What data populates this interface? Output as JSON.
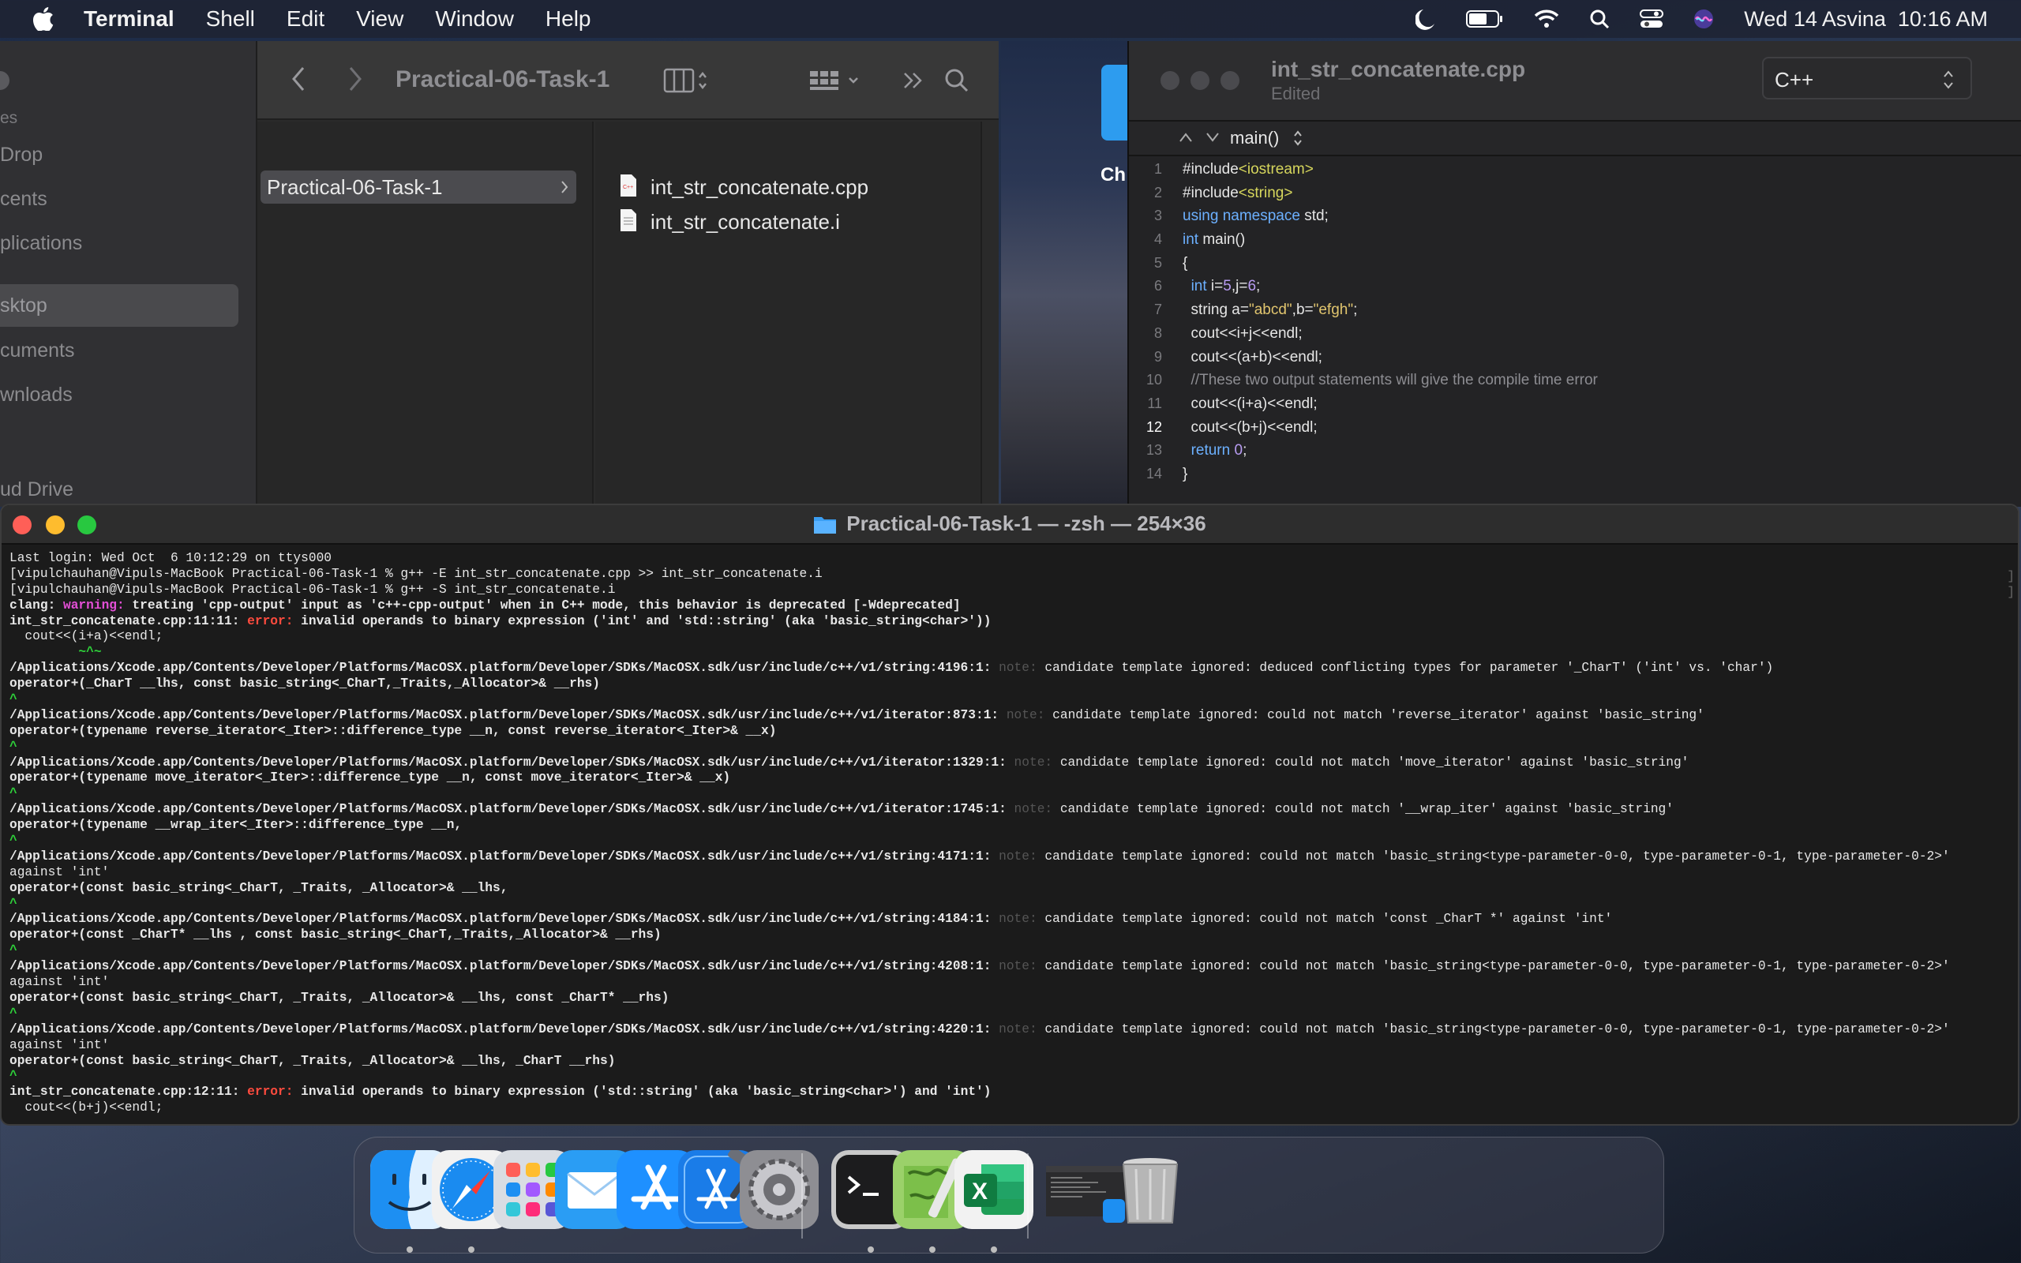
{
  "menubar": {
    "app": "Terminal",
    "items": [
      "Shell",
      "Edit",
      "View",
      "Window",
      "Help"
    ],
    "datetime": "Wed 14 Asvina  10:16 AM"
  },
  "finder": {
    "sidebar": {
      "section_label": "es",
      "items": [
        "Drop",
        "cents",
        "plications",
        "sktop",
        "cuments",
        "wnloads"
      ],
      "cloud_label": "ud Drive"
    },
    "toolbar": {
      "title": "Practical-06-Task-1"
    },
    "column1": {
      "folder": "Practical-06-Task-1"
    },
    "column2": {
      "files": [
        "int_str_concatenate.cpp",
        "int_str_concatenate.i"
      ]
    }
  },
  "desktop": {
    "partial_label": "Ch"
  },
  "editor": {
    "filename": "int_str_concatenate.cpp",
    "status": "Edited",
    "language": "C++",
    "jump": "main()",
    "current_line": "12",
    "lines": [
      {
        "n": "1",
        "parts": [
          {
            "t": "#include",
            "c": ""
          },
          {
            "t": "<iostream>",
            "c": "inc"
          }
        ]
      },
      {
        "n": "2",
        "parts": [
          {
            "t": "#include",
            "c": ""
          },
          {
            "t": "<string>",
            "c": "inc"
          }
        ]
      },
      {
        "n": "3",
        "parts": [
          {
            "t": "using namespace",
            "c": "kw"
          },
          {
            "t": " std;",
            "c": ""
          }
        ]
      },
      {
        "n": "4",
        "parts": [
          {
            "t": "int",
            "c": "kw"
          },
          {
            "t": " main()",
            "c": ""
          }
        ]
      },
      {
        "n": "5",
        "parts": [
          {
            "t": "{",
            "c": ""
          }
        ]
      },
      {
        "n": "6",
        "parts": [
          {
            "t": "  ",
            "c": ""
          },
          {
            "t": "int",
            "c": "kw"
          },
          {
            "t": " i=",
            "c": ""
          },
          {
            "t": "5",
            "c": "num"
          },
          {
            "t": ",j=",
            "c": ""
          },
          {
            "t": "6",
            "c": "num"
          },
          {
            "t": ";",
            "c": ""
          }
        ]
      },
      {
        "n": "7",
        "parts": [
          {
            "t": "  string a=",
            "c": ""
          },
          {
            "t": "\"abcd\"",
            "c": "strv"
          },
          {
            "t": ",b=",
            "c": ""
          },
          {
            "t": "\"efgh\"",
            "c": "strv"
          },
          {
            "t": ";",
            "c": ""
          }
        ]
      },
      {
        "n": "8",
        "parts": [
          {
            "t": "  cout<<i+j<<endl;",
            "c": ""
          }
        ]
      },
      {
        "n": "9",
        "parts": [
          {
            "t": "  cout<<(a+b)<<endl;",
            "c": ""
          }
        ]
      },
      {
        "n": "10",
        "parts": [
          {
            "t": "  //These two output statements will give the compile time error",
            "c": "cmt"
          }
        ]
      },
      {
        "n": "11",
        "parts": [
          {
            "t": "  cout<<(i+a)<<endl;",
            "c": ""
          }
        ]
      },
      {
        "n": "12",
        "parts": [
          {
            "t": "  cout<<(b+j)<<endl;",
            "c": ""
          }
        ]
      },
      {
        "n": "13",
        "parts": [
          {
            "t": "  ",
            "c": ""
          },
          {
            "t": "return",
            "c": "kw"
          },
          {
            "t": " ",
            "c": ""
          },
          {
            "t": "0",
            "c": "num"
          },
          {
            "t": ";",
            "c": ""
          }
        ]
      },
      {
        "n": "14",
        "parts": [
          {
            "t": "}",
            "c": ""
          }
        ]
      }
    ]
  },
  "terminal": {
    "title": "Practical-06-Task-1 — -zsh — 254×36",
    "lines": [
      [
        {
          "t": "Last login: Wed Oct  6 10:12:29 on ttys000",
          "c": ""
        }
      ],
      [
        {
          "t": "[vipulchauhan@Vipuls-MacBook Practical-06-Task-1 % g++ -E int_str_concatenate.cpp >> int_str_concatenate.i",
          "c": ""
        }
      ],
      [
        {
          "t": "[vipulchauhan@Vipuls-MacBook Practical-06-Task-1 % g++ -S int_str_concatenate.i",
          "c": ""
        }
      ],
      [
        {
          "t": "clang: ",
          "c": "b"
        },
        {
          "t": "warning:",
          "c": "warn"
        },
        {
          "t": " treating 'cpp-output' input as 'c++-cpp-output' when in C++ mode, this behavior is deprecated [-Wdeprecated]",
          "c": "b"
        }
      ],
      [
        {
          "t": "int_str_concatenate.cpp:11:11: ",
          "c": "b"
        },
        {
          "t": "error:",
          "c": "err"
        },
        {
          "t": " invalid operands to binary expression ('int' and 'std::string' (aka 'basic_string<char>'))",
          "c": "b"
        }
      ],
      [
        {
          "t": "  cout<<(i+a)<<endl;",
          "c": ""
        }
      ],
      [
        {
          "t": "         ~^~",
          "c": "grn"
        }
      ],
      [
        {
          "t": "/Applications/Xcode.app/Contents/Developer/Platforms/MacOSX.platform/Developer/SDKs/MacOSX.sdk/usr/include/c++/v1/string:4196:1: ",
          "c": "b"
        },
        {
          "t": "note:",
          "c": "note"
        },
        {
          "t": " candidate template ignored: deduced conflicting types for parameter '_CharT' ('int' vs. 'char')",
          "c": ""
        }
      ],
      [
        {
          "t": "operator+(_CharT __lhs, const basic_string<_CharT,_Traits,_Allocator>& __rhs)",
          "c": "b"
        }
      ],
      [
        {
          "t": "^",
          "c": "grn"
        }
      ],
      [
        {
          "t": "/Applications/Xcode.app/Contents/Developer/Platforms/MacOSX.platform/Developer/SDKs/MacOSX.sdk/usr/include/c++/v1/iterator:873:1: ",
          "c": "b"
        },
        {
          "t": "note:",
          "c": "note"
        },
        {
          "t": " candidate template ignored: could not match 'reverse_iterator' against 'basic_string'",
          "c": ""
        }
      ],
      [
        {
          "t": "operator+(typename reverse_iterator<_Iter>::difference_type __n, const reverse_iterator<_Iter>& __x)",
          "c": "b"
        }
      ],
      [
        {
          "t": "^",
          "c": "grn"
        }
      ],
      [
        {
          "t": "/Applications/Xcode.app/Contents/Developer/Platforms/MacOSX.platform/Developer/SDKs/MacOSX.sdk/usr/include/c++/v1/iterator:1329:1: ",
          "c": "b"
        },
        {
          "t": "note:",
          "c": "note"
        },
        {
          "t": " candidate template ignored: could not match 'move_iterator' against 'basic_string'",
          "c": ""
        }
      ],
      [
        {
          "t": "operator+(typename move_iterator<_Iter>::difference_type __n, const move_iterator<_Iter>& __x)",
          "c": "b"
        }
      ],
      [
        {
          "t": "^",
          "c": "grn"
        }
      ],
      [
        {
          "t": "/Applications/Xcode.app/Contents/Developer/Platforms/MacOSX.platform/Developer/SDKs/MacOSX.sdk/usr/include/c++/v1/iterator:1745:1: ",
          "c": "b"
        },
        {
          "t": "note:",
          "c": "note"
        },
        {
          "t": " candidate template ignored: could not match '__wrap_iter' against 'basic_string'",
          "c": ""
        }
      ],
      [
        {
          "t": "operator+(typename __wrap_iter<_Iter>::difference_type __n,",
          "c": "b"
        }
      ],
      [
        {
          "t": "^",
          "c": "grn"
        }
      ],
      [
        {
          "t": "/Applications/Xcode.app/Contents/Developer/Platforms/MacOSX.platform/Developer/SDKs/MacOSX.sdk/usr/include/c++/v1/string:4171:1: ",
          "c": "b"
        },
        {
          "t": "note:",
          "c": "note"
        },
        {
          "t": " candidate template ignored: could not match 'basic_string<type-parameter-0-0, type-parameter-0-1, type-parameter-0-2>'",
          "c": ""
        }
      ],
      [
        {
          "t": "against 'int'",
          "c": ""
        }
      ],
      [
        {
          "t": "operator+(const basic_string<_CharT, _Traits, _Allocator>& __lhs,",
          "c": "b"
        }
      ],
      [
        {
          "t": "^",
          "c": "grn"
        }
      ],
      [
        {
          "t": "/Applications/Xcode.app/Contents/Developer/Platforms/MacOSX.platform/Developer/SDKs/MacOSX.sdk/usr/include/c++/v1/string:4184:1: ",
          "c": "b"
        },
        {
          "t": "note:",
          "c": "note"
        },
        {
          "t": " candidate template ignored: could not match 'const _CharT *' against 'int'",
          "c": ""
        }
      ],
      [
        {
          "t": "operator+(const _CharT* __lhs , const basic_string<_CharT,_Traits,_Allocator>& __rhs)",
          "c": "b"
        }
      ],
      [
        {
          "t": "^",
          "c": "grn"
        }
      ],
      [
        {
          "t": "/Applications/Xcode.app/Contents/Developer/Platforms/MacOSX.platform/Developer/SDKs/MacOSX.sdk/usr/include/c++/v1/string:4208:1: ",
          "c": "b"
        },
        {
          "t": "note:",
          "c": "note"
        },
        {
          "t": " candidate template ignored: could not match 'basic_string<type-parameter-0-0, type-parameter-0-1, type-parameter-0-2>'",
          "c": ""
        }
      ],
      [
        {
          "t": "against 'int'",
          "c": ""
        }
      ],
      [
        {
          "t": "operator+(const basic_string<_CharT, _Traits, _Allocator>& __lhs, const _CharT* __rhs)",
          "c": "b"
        }
      ],
      [
        {
          "t": "^",
          "c": "grn"
        }
      ],
      [
        {
          "t": "/Applications/Xcode.app/Contents/Developer/Platforms/MacOSX.platform/Developer/SDKs/MacOSX.sdk/usr/include/c++/v1/string:4220:1: ",
          "c": "b"
        },
        {
          "t": "note:",
          "c": "note"
        },
        {
          "t": " candidate template ignored: could not match 'basic_string<type-parameter-0-0, type-parameter-0-1, type-parameter-0-2>'",
          "c": ""
        }
      ],
      [
        {
          "t": "against 'int'",
          "c": ""
        }
      ],
      [
        {
          "t": "operator+(const basic_string<_CharT, _Traits, _Allocator>& __lhs, _CharT __rhs)",
          "c": "b"
        }
      ],
      [
        {
          "t": "^",
          "c": "grn"
        }
      ],
      [
        {
          "t": "int_str_concatenate.cpp:12:11: ",
          "c": "b"
        },
        {
          "t": "error:",
          "c": "err"
        },
        {
          "t": " invalid operands to binary expression ('std::string' (aka 'basic_string<char>') and 'int')",
          "c": "b"
        }
      ],
      [
        {
          "t": "  cout<<(b+j)<<endl;",
          "c": ""
        }
      ]
    ]
  },
  "dock": {
    "apps": [
      {
        "name": "finder-icon",
        "running": true
      },
      {
        "name": "safari-icon",
        "running": true
      },
      {
        "name": "launchpad-icon",
        "running": false
      },
      {
        "name": "mail-icon",
        "running": false
      },
      {
        "name": "app-store-icon",
        "running": false
      },
      {
        "name": "xcode-icon",
        "running": false
      },
      {
        "name": "system-preferences-icon",
        "running": false
      },
      {
        "name": "terminal-icon",
        "running": true
      },
      {
        "name": "script-editor-icon",
        "running": true
      },
      {
        "name": "excel-icon",
        "running": true
      },
      {
        "name": "finder-window-thumbnail-icon",
        "running": false
      },
      {
        "name": "trash-icon",
        "running": false
      }
    ],
    "excel_letter": "X",
    "terminal_glyph": ">_"
  }
}
